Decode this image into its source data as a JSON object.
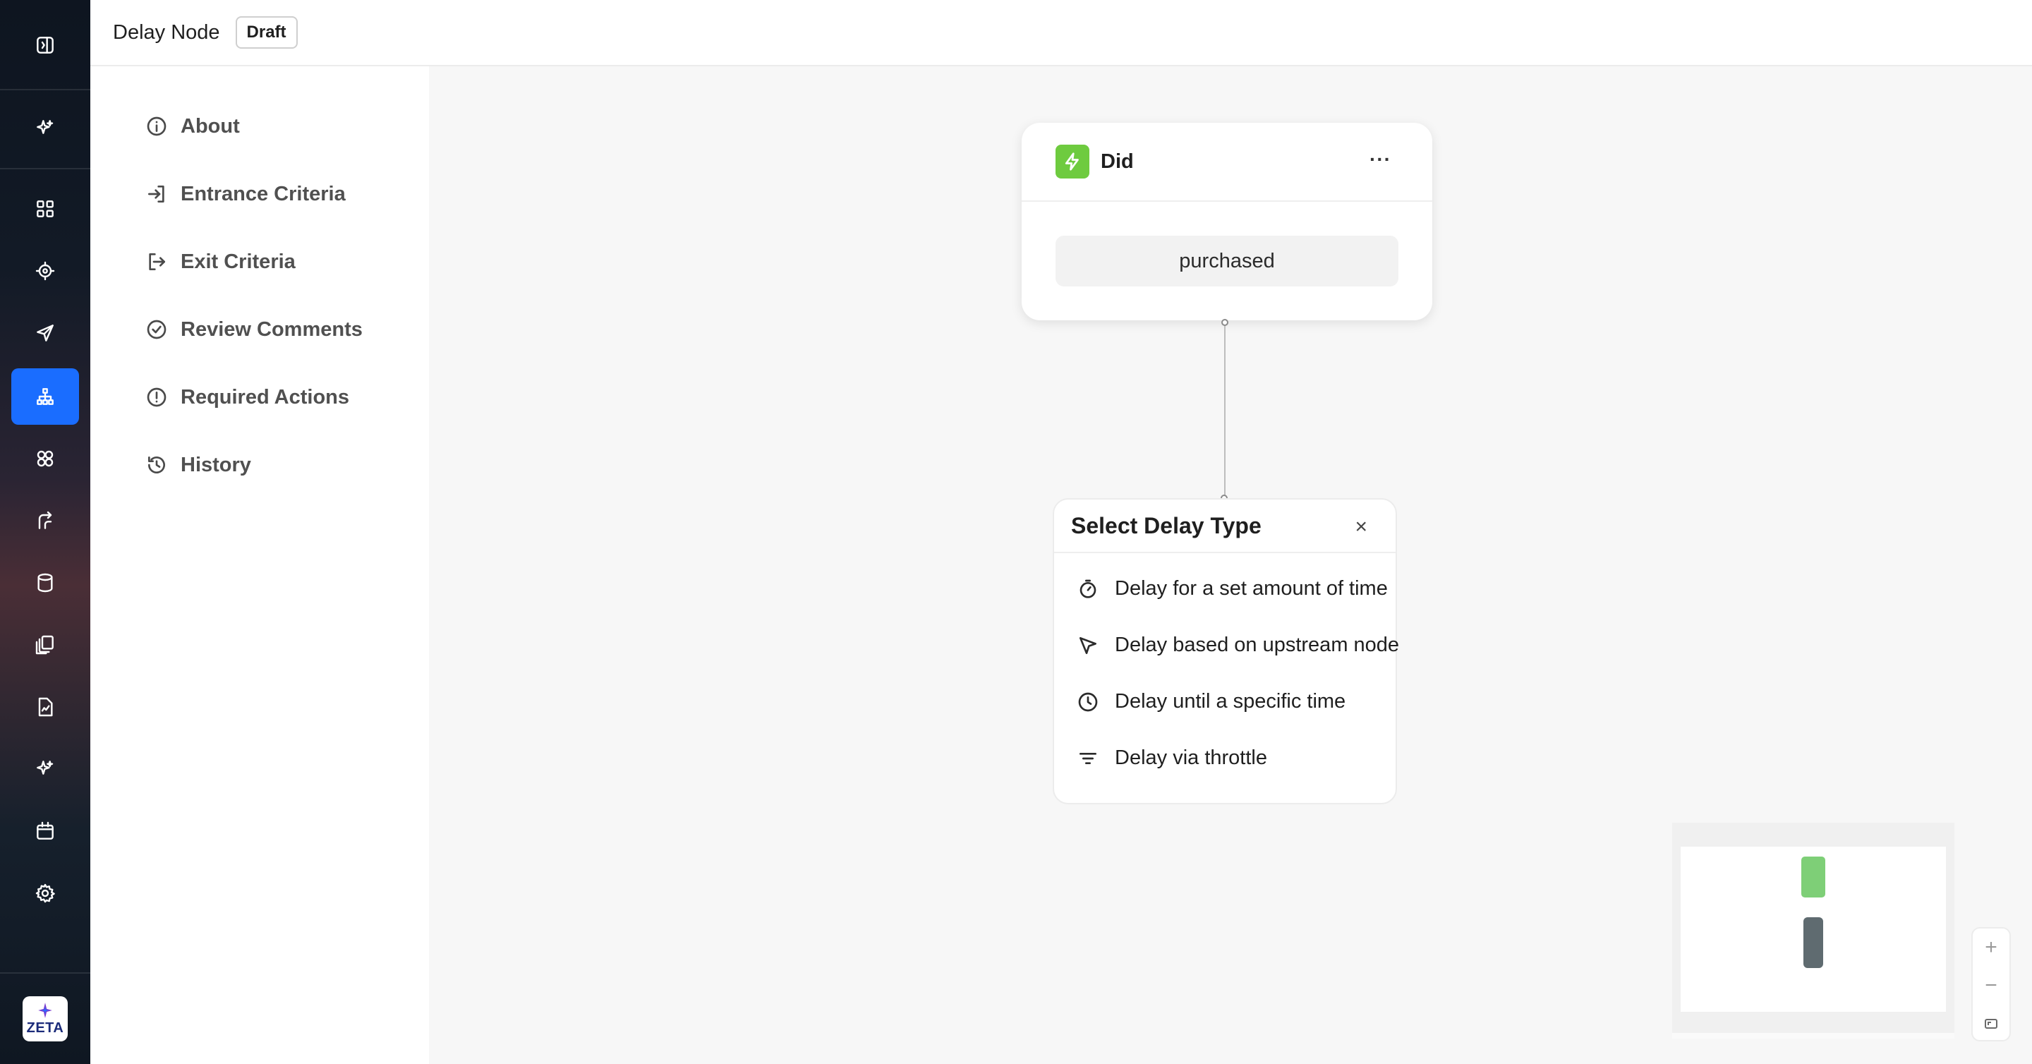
{
  "header": {
    "title": "Delay Node",
    "status_badge": "Draft"
  },
  "rail": {
    "items": [
      {
        "icon": "collapse-panel-icon"
      },
      {
        "icon": "sparkle-icon"
      },
      {
        "icon": "dashboard-grid-icon"
      },
      {
        "icon": "target-icon"
      },
      {
        "icon": "send-icon"
      },
      {
        "icon": "hierarchy-icon",
        "active": true
      },
      {
        "icon": "segments-icon"
      },
      {
        "icon": "journey-icon"
      },
      {
        "icon": "database-icon"
      },
      {
        "icon": "content-library-icon"
      },
      {
        "icon": "reports-icon"
      },
      {
        "icon": "ai-sparkle-icon"
      },
      {
        "icon": "calendar-icon"
      },
      {
        "icon": "settings-gear-icon"
      }
    ],
    "logo_text": "ZETA"
  },
  "sidemenu": {
    "items": [
      {
        "label": "About",
        "icon": "info-icon"
      },
      {
        "label": "Entrance Criteria",
        "icon": "enter-icon"
      },
      {
        "label": "Exit Criteria",
        "icon": "exit-icon"
      },
      {
        "label": "Review Comments",
        "icon": "check-circle-icon"
      },
      {
        "label": "Required Actions",
        "icon": "alert-circle-icon"
      },
      {
        "label": "History",
        "icon": "history-icon"
      }
    ]
  },
  "canvas": {
    "trigger_node": {
      "title": "Did",
      "more_label": "···",
      "event": "purchased"
    },
    "delay_picker": {
      "title": "Select Delay Type",
      "close_label": "×",
      "options": [
        {
          "label": "Delay for a set amount of time",
          "icon": "timer-icon"
        },
        {
          "label": "Delay based on upstream node",
          "icon": "cursor-arrow-icon"
        },
        {
          "label": "Delay until a specific time",
          "icon": "clock-icon"
        },
        {
          "label": "Delay via throttle",
          "icon": "filter-lines-icon"
        }
      ]
    },
    "zoom": {
      "in_label": "+",
      "out_label": "−"
    }
  },
  "colors": {
    "accent": "#1a6dff",
    "trigger": "#6ecb3f"
  }
}
